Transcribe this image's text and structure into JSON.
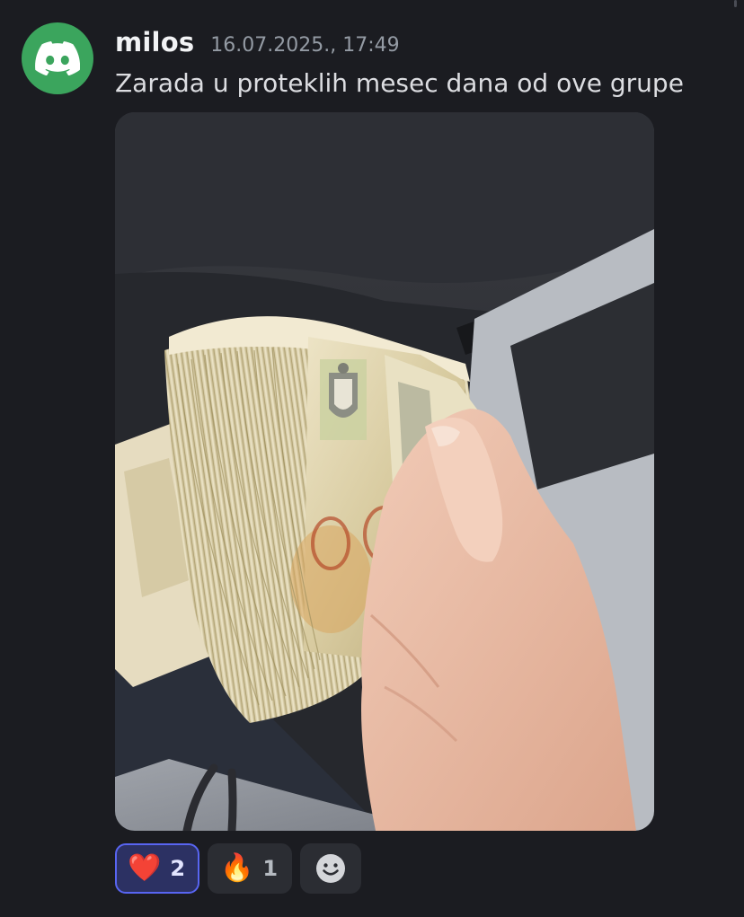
{
  "message": {
    "author": "milos",
    "timestamp": "16.07.2025., 17:49",
    "text": "Zarada u proteklih mesec dana od ove grupe",
    "avatar_icon": "discord-logo-icon",
    "avatar_color": "#3ba55d"
  },
  "attachment": {
    "type": "image",
    "depicts": "hand-holding-stack-of-banknotes"
  },
  "reactions": [
    {
      "emoji": "❤️",
      "icon": "heart-icon",
      "count": "2",
      "reacted_by_me": true
    },
    {
      "emoji": "🔥",
      "icon": "fire-icon",
      "count": "1",
      "reacted_by_me": false
    }
  ],
  "add_reaction": {
    "icon": "add-reaction-smiley-icon"
  },
  "colors": {
    "background": "#1b1c21",
    "username": "#f2f3f5",
    "timestamp": "#949ba4",
    "text": "#dcdde1",
    "reaction_active_border": "#5865f2",
    "reaction_active_bg": "#2c3163",
    "reaction_bg": "#2b2d33"
  }
}
